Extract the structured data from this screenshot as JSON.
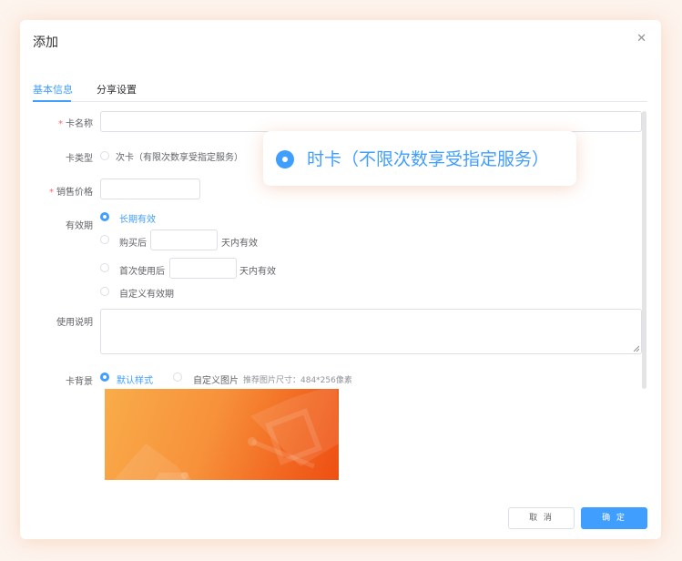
{
  "dialog": {
    "title": "添加",
    "close_icon": "close-icon"
  },
  "tabs": [
    {
      "label": "基本信息",
      "active": true
    },
    {
      "label": "分享设置",
      "active": false
    }
  ],
  "form": {
    "card_name": {
      "label": "卡名称",
      "required": true,
      "value": ""
    },
    "card_type": {
      "label": "卡类型",
      "option": "次卡（有限次数享受指定服务）"
    },
    "price": {
      "label": "销售价格",
      "required": true,
      "value": ""
    },
    "validity": {
      "label": "有效期",
      "options": [
        {
          "label": "长期有效",
          "selected": true
        },
        {
          "prefix": "购买后",
          "suffix": "天内有效",
          "selected": false,
          "value": ""
        },
        {
          "prefix": "首次使用后",
          "suffix": "天内有效",
          "selected": false,
          "value": ""
        },
        {
          "label": "自定义有效期",
          "selected": false
        }
      ]
    },
    "description": {
      "label": "使用说明",
      "value": ""
    },
    "background": {
      "label": "卡背景",
      "default_option": "默认样式",
      "custom_option": "自定义图片",
      "hint": "推荐图片尺寸：484*256像素"
    }
  },
  "callout": {
    "text": "时卡（不限次数享受指定服务）"
  },
  "footer": {
    "cancel_label": "取 消",
    "confirm_label": "确 定"
  },
  "colors": {
    "accent": "#409eff",
    "required": "#f56c6c",
    "card_gradient": [
      "#f9ac4a",
      "#ee4f12"
    ]
  }
}
